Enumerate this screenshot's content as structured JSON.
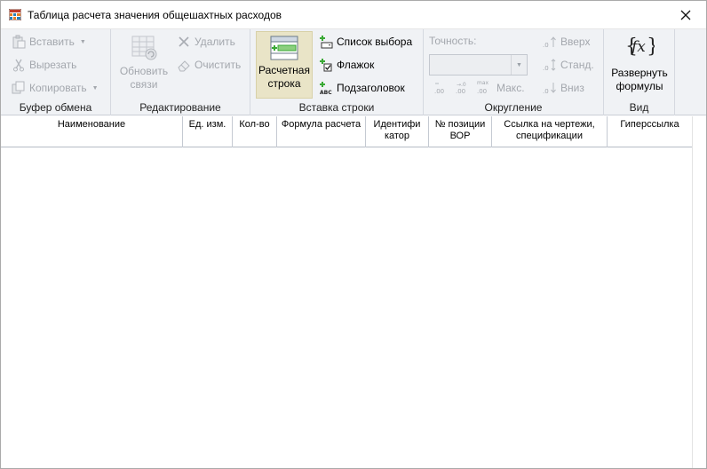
{
  "window": {
    "title": "Таблица расчета значения общешахтных расходов"
  },
  "ribbon": {
    "clipboard": {
      "caption": "Буфер обмена",
      "paste": "Вставить",
      "cut": "Вырезать",
      "copy": "Копировать"
    },
    "editing": {
      "caption": "Редактирование",
      "refresh_line1": "Обновить",
      "refresh_line2": "связи",
      "delete": "Удалить",
      "clear": "Очистить"
    },
    "insert_row": {
      "caption": "Вставка строки",
      "calc_row_line1": "Расчетная",
      "calc_row_line2": "строка",
      "select_list": "Список выбора",
      "checkbox": "Флажок",
      "subheader": "Подзаголовок"
    },
    "rounding": {
      "caption": "Округление",
      "precision_label": "Точность:",
      "precision_value": "",
      "max": "Макс.",
      "up": "Вверх",
      "standard": "Станд.",
      "down": "Вниз"
    },
    "view": {
      "caption": "Вид",
      "expand_line1": "Развернуть",
      "expand_line2": "формулы"
    }
  },
  "grid": {
    "columns": [
      {
        "line1": "Наименование",
        "line2": ""
      },
      {
        "line1": "Ед. изм.",
        "line2": ""
      },
      {
        "line1": "Кол-во",
        "line2": ""
      },
      {
        "line1": "Формула расчета",
        "line2": ""
      },
      {
        "line1": "Идентифи",
        "line2": "катор"
      },
      {
        "line1": "№ позиции",
        "line2": "ВОР"
      },
      {
        "line1": "Ссылка на чертежи,",
        "line2": "спецификации"
      },
      {
        "line1": "Гиперссылка",
        "line2": ""
      }
    ],
    "rows": []
  },
  "colors": {
    "ribbon_bg": "#f0f2f5",
    "disabled_text": "#a3a7ad",
    "accent_green": "#3aa935"
  }
}
